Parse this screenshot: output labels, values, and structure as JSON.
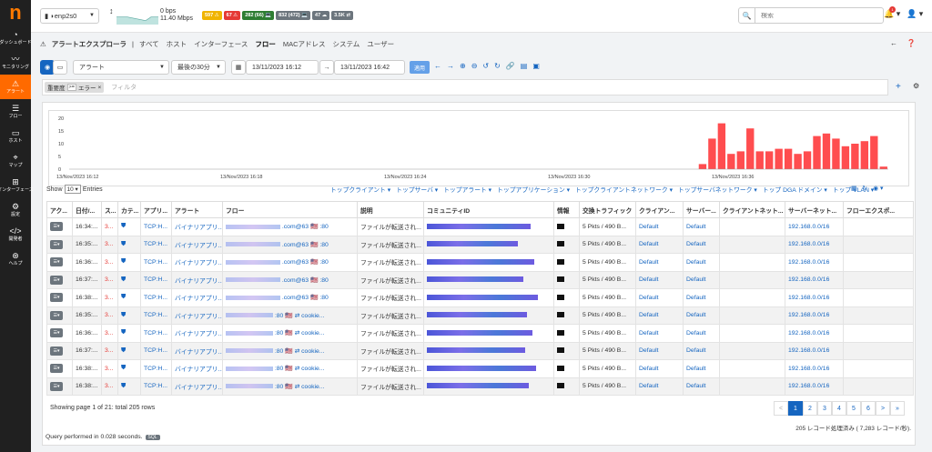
{
  "sidebar": {
    "logo": "n",
    "items": [
      {
        "label": "ダッシュボード",
        "icon": "gauge-icon"
      },
      {
        "label": "モニタリング",
        "icon": "pulse-icon"
      },
      {
        "label": "アラート",
        "icon": "warning-icon",
        "active": true
      },
      {
        "label": "フロー",
        "icon": "flows-icon"
      },
      {
        "label": "ホスト",
        "icon": "laptop-icon"
      },
      {
        "label": "マップ",
        "icon": "map-icon"
      },
      {
        "label": "インターフェース",
        "icon": "ethernet-icon"
      },
      {
        "label": "設定",
        "icon": "gear-icon"
      },
      {
        "label": "開発者",
        "icon": "code-icon"
      },
      {
        "label": "ヘルプ",
        "icon": "lifebuoy-icon"
      }
    ]
  },
  "topbar": {
    "interface": "enp2s0",
    "throughput_top": "0 bps",
    "throughput_bottom": "11.40 Mbps",
    "badges": [
      {
        "text": "597 ⚠",
        "color": "#f0b400"
      },
      {
        "text": "67 ⚠",
        "color": "#e53935"
      },
      {
        "text": "282 (66) 💻",
        "color": "#2e7d32"
      },
      {
        "text": "832 (472) 💻",
        "color": "#6c757d"
      },
      {
        "text": "47 ☁",
        "color": "#6c757d"
      },
      {
        "text": "3.5K ⇄",
        "color": "#6c757d"
      }
    ],
    "search_placeholder": "検索",
    "notif_count": "1"
  },
  "nav": {
    "title": "アラートエクスプローラ",
    "tabs": [
      "すべて",
      "ホスト",
      "インターフェース",
      "フロー",
      "MACアドレス",
      "システム",
      "ユーザー"
    ],
    "active_tab": "フロー"
  },
  "toolbar": {
    "alert_type": "アラート",
    "period": "最後の30分",
    "from": "13/11/2023 16:12",
    "to": "13/11/2023 16:42",
    "apply": "適用"
  },
  "filter": {
    "tag_label": "重要度",
    "tag_op": ">=",
    "tag_value": "エラー",
    "placeholder": "フィルタ"
  },
  "chart_data": {
    "type": "bar",
    "ylim": [
      0,
      20
    ],
    "yticks": [
      "20",
      "15",
      "10",
      "5",
      "0"
    ],
    "xticks": [
      "13/Nov/2023 16:12",
      "13/Nov/2023 16:18",
      "13/Nov/2023 16:24",
      "13/Nov/2023 16:30",
      "13/Nov/2023 16:36"
    ],
    "values": [
      0,
      0,
      0,
      0,
      0,
      0,
      0,
      0,
      0,
      0,
      0,
      0,
      0,
      0,
      0,
      0,
      0,
      0,
      0,
      0,
      0,
      0,
      0,
      0,
      0,
      0,
      0,
      0,
      0,
      0,
      0,
      0,
      0,
      0,
      0,
      0,
      0,
      0,
      0,
      0,
      0,
      0,
      0,
      0,
      0,
      0,
      0,
      0,
      0,
      0,
      0,
      0,
      0,
      0,
      0,
      0,
      0,
      0,
      0,
      0,
      0,
      0,
      0,
      0,
      0,
      0,
      2,
      12,
      18,
      6,
      7,
      16,
      7,
      7,
      8,
      8,
      6,
      7,
      13,
      14,
      12,
      9,
      10,
      11,
      13,
      1
    ],
    "color": "#ff4d4f"
  },
  "table": {
    "show_label": "Show",
    "show_value": "10",
    "entries_label": "Entries",
    "dropdowns": [
      "トップクライアント ▾",
      "トップサーバ ▾",
      "トップアラート ▾",
      "トップアプリケーション ▾",
      "トップクライアントネットワーク ▾",
      "トップサーバネットワーク ▾",
      "トップ DGA ドメイン ▾",
      "トップ VLAN ▾"
    ],
    "columns": [
      "アク...",
      "日付/...",
      "ス...",
      "カテ...",
      "アプリ...",
      "アラート",
      "フロー",
      "説明",
      "コミュニティID",
      "情報",
      "交換トラフィック",
      "クライアン...",
      "サーバー...",
      "クライアントネット...",
      "サーバーネット...",
      "フローエクスポ..."
    ],
    "rows": [
      {
        "time": "16:34:...",
        "score": "3...",
        "app": "TCP:H...",
        "alert": "バイナリアプリ...",
        "flow": ".com@63 🇺🇸 :80",
        "desc": "ファイルが転送され...",
        "traffic": "5 Pkts / 490 B...",
        "client_pool": "Default",
        "server_pool": "Default",
        "server_net": "192.168.0.0/16"
      },
      {
        "time": "16:35:...",
        "score": "3...",
        "app": "TCP:H...",
        "alert": "バイナリアプリ...",
        "flow": ".com@63 🇺🇸 :80",
        "desc": "ファイルが転送され...",
        "traffic": "5 Pkts / 490 B...",
        "client_pool": "Default",
        "server_pool": "Default",
        "server_net": "192.168.0.0/16"
      },
      {
        "time": "16:36:...",
        "score": "3...",
        "app": "TCP:H...",
        "alert": "バイナリアプリ...",
        "flow": ".com@63 🇺🇸 :80",
        "desc": "ファイルが転送され...",
        "traffic": "5 Pkts / 490 B...",
        "client_pool": "Default",
        "server_pool": "Default",
        "server_net": "192.168.0.0/16"
      },
      {
        "time": "16:37:...",
        "score": "3...",
        "app": "TCP:H...",
        "alert": "バイナリアプリ...",
        "flow": ".com@63 🇺🇸 :80",
        "desc": "ファイルが転送され...",
        "traffic": "5 Pkts / 490 B...",
        "client_pool": "Default",
        "server_pool": "Default",
        "server_net": "192.168.0.0/16"
      },
      {
        "time": "16:38:...",
        "score": "3...",
        "app": "TCP:H...",
        "alert": "バイナリアプリ...",
        "flow": ".com@63 🇺🇸 :80",
        "desc": "ファイルが転送され...",
        "traffic": "5 Pkts / 490 B...",
        "client_pool": "Default",
        "server_pool": "Default",
        "server_net": "192.168.0.0/16"
      },
      {
        "time": "16:35:...",
        "score": "3...",
        "app": "TCP:H...",
        "alert": "バイナリアプリ...",
        "flow": ":80 🇺🇸 ⇄ cookie...",
        "desc": "ファイルが転送され...",
        "traffic": "5 Pkts / 490 B...",
        "client_pool": "Default",
        "server_pool": "Default",
        "server_net": "192.168.0.0/16"
      },
      {
        "time": "16:36:...",
        "score": "3...",
        "app": "TCP:H...",
        "alert": "バイナリアプリ...",
        "flow": ":80 🇺🇸 ⇄ cookie...",
        "desc": "ファイルが転送され...",
        "traffic": "5 Pkts / 490 B...",
        "client_pool": "Default",
        "server_pool": "Default",
        "server_net": "192.168.0.0/16"
      },
      {
        "time": "16:37:...",
        "score": "3...",
        "app": "TCP:H...",
        "alert": "バイナリアプリ...",
        "flow": ":80 🇺🇸 ⇄ cookie...",
        "desc": "ファイルが転送され...",
        "traffic": "5 Pkts / 490 B...",
        "client_pool": "Default",
        "server_pool": "Default",
        "server_net": "192.168.0.0/16"
      },
      {
        "time": "16:38:...",
        "score": "3...",
        "app": "TCP:H...",
        "alert": "バイナリアプリ...",
        "flow": ":80 🇺🇸 ⇄ cookie...",
        "desc": "ファイルが転送され...",
        "traffic": "5 Pkts / 490 B...",
        "client_pool": "Default",
        "server_pool": "Default",
        "server_net": "192.168.0.0/16"
      },
      {
        "time": "16:38:...",
        "score": "3...",
        "app": "TCP:H...",
        "alert": "バイナリアプリ...",
        "flow": ":80 🇺🇸 ⇄ cookie...",
        "desc": "ファイルが転送され...",
        "traffic": "5 Pkts / 490 B...",
        "client_pool": "Default",
        "server_pool": "Default",
        "server_net": "192.168.0.0/16"
      }
    ],
    "showing": "Showing page 1 of 21: total 205 rows",
    "pages": [
      "<",
      "1",
      "2",
      "3",
      "4",
      "5",
      "6",
      ">",
      "»"
    ],
    "records": "205 レコード処理済み ( 7,283 レコード/秒)."
  },
  "query": {
    "text": "Query performed in 0.028 seconds.",
    "badge": "SQL"
  }
}
